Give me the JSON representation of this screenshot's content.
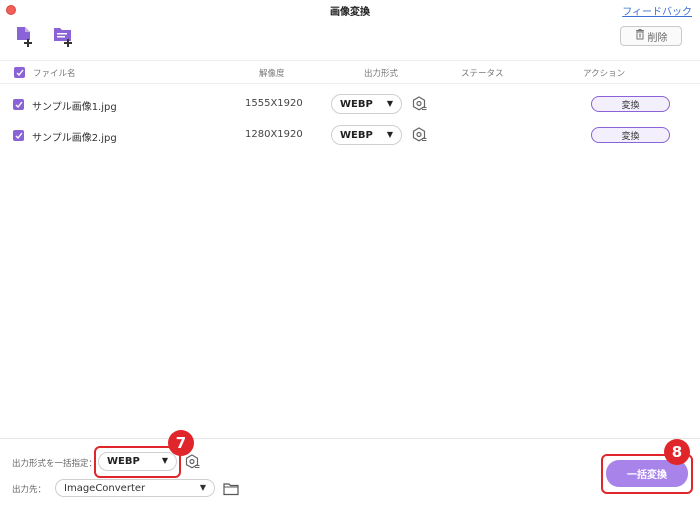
{
  "window": {
    "title": "画像変換",
    "feedback_link": "フィードバック"
  },
  "toolbar": {
    "add_file_icon": "add-file-icon",
    "add_folder_icon": "add-folder-icon",
    "delete_label": "削除"
  },
  "table": {
    "headers": {
      "filename": "ファイル名",
      "resolution": "解像度",
      "output_format": "出力形式",
      "status": "ステータス",
      "action": "アクション"
    },
    "rows": [
      {
        "filename": "サンプル画像1.jpg",
        "resolution": "1555X1920",
        "format": "WEBP",
        "status": "",
        "action": "変換",
        "checked": true
      },
      {
        "filename": "サンプル画像2.jpg",
        "resolution": "1280X1920",
        "format": "WEBP",
        "status": "",
        "action": "変換",
        "checked": true
      }
    ]
  },
  "bottom": {
    "batch_format_label": "出力形式を一括指定：",
    "batch_format_value": "WEBP",
    "output_dest_label": "出力先：",
    "output_dest_value": "ImageConverter",
    "batch_convert_label": "一括変換"
  },
  "annotations": {
    "badge_7": "7",
    "badge_8": "8"
  },
  "colors": {
    "accent": "#8a63d6",
    "accent_light": "#a884ea",
    "highlight_red": "#e0262a",
    "link_blue": "#3b6fd6"
  }
}
